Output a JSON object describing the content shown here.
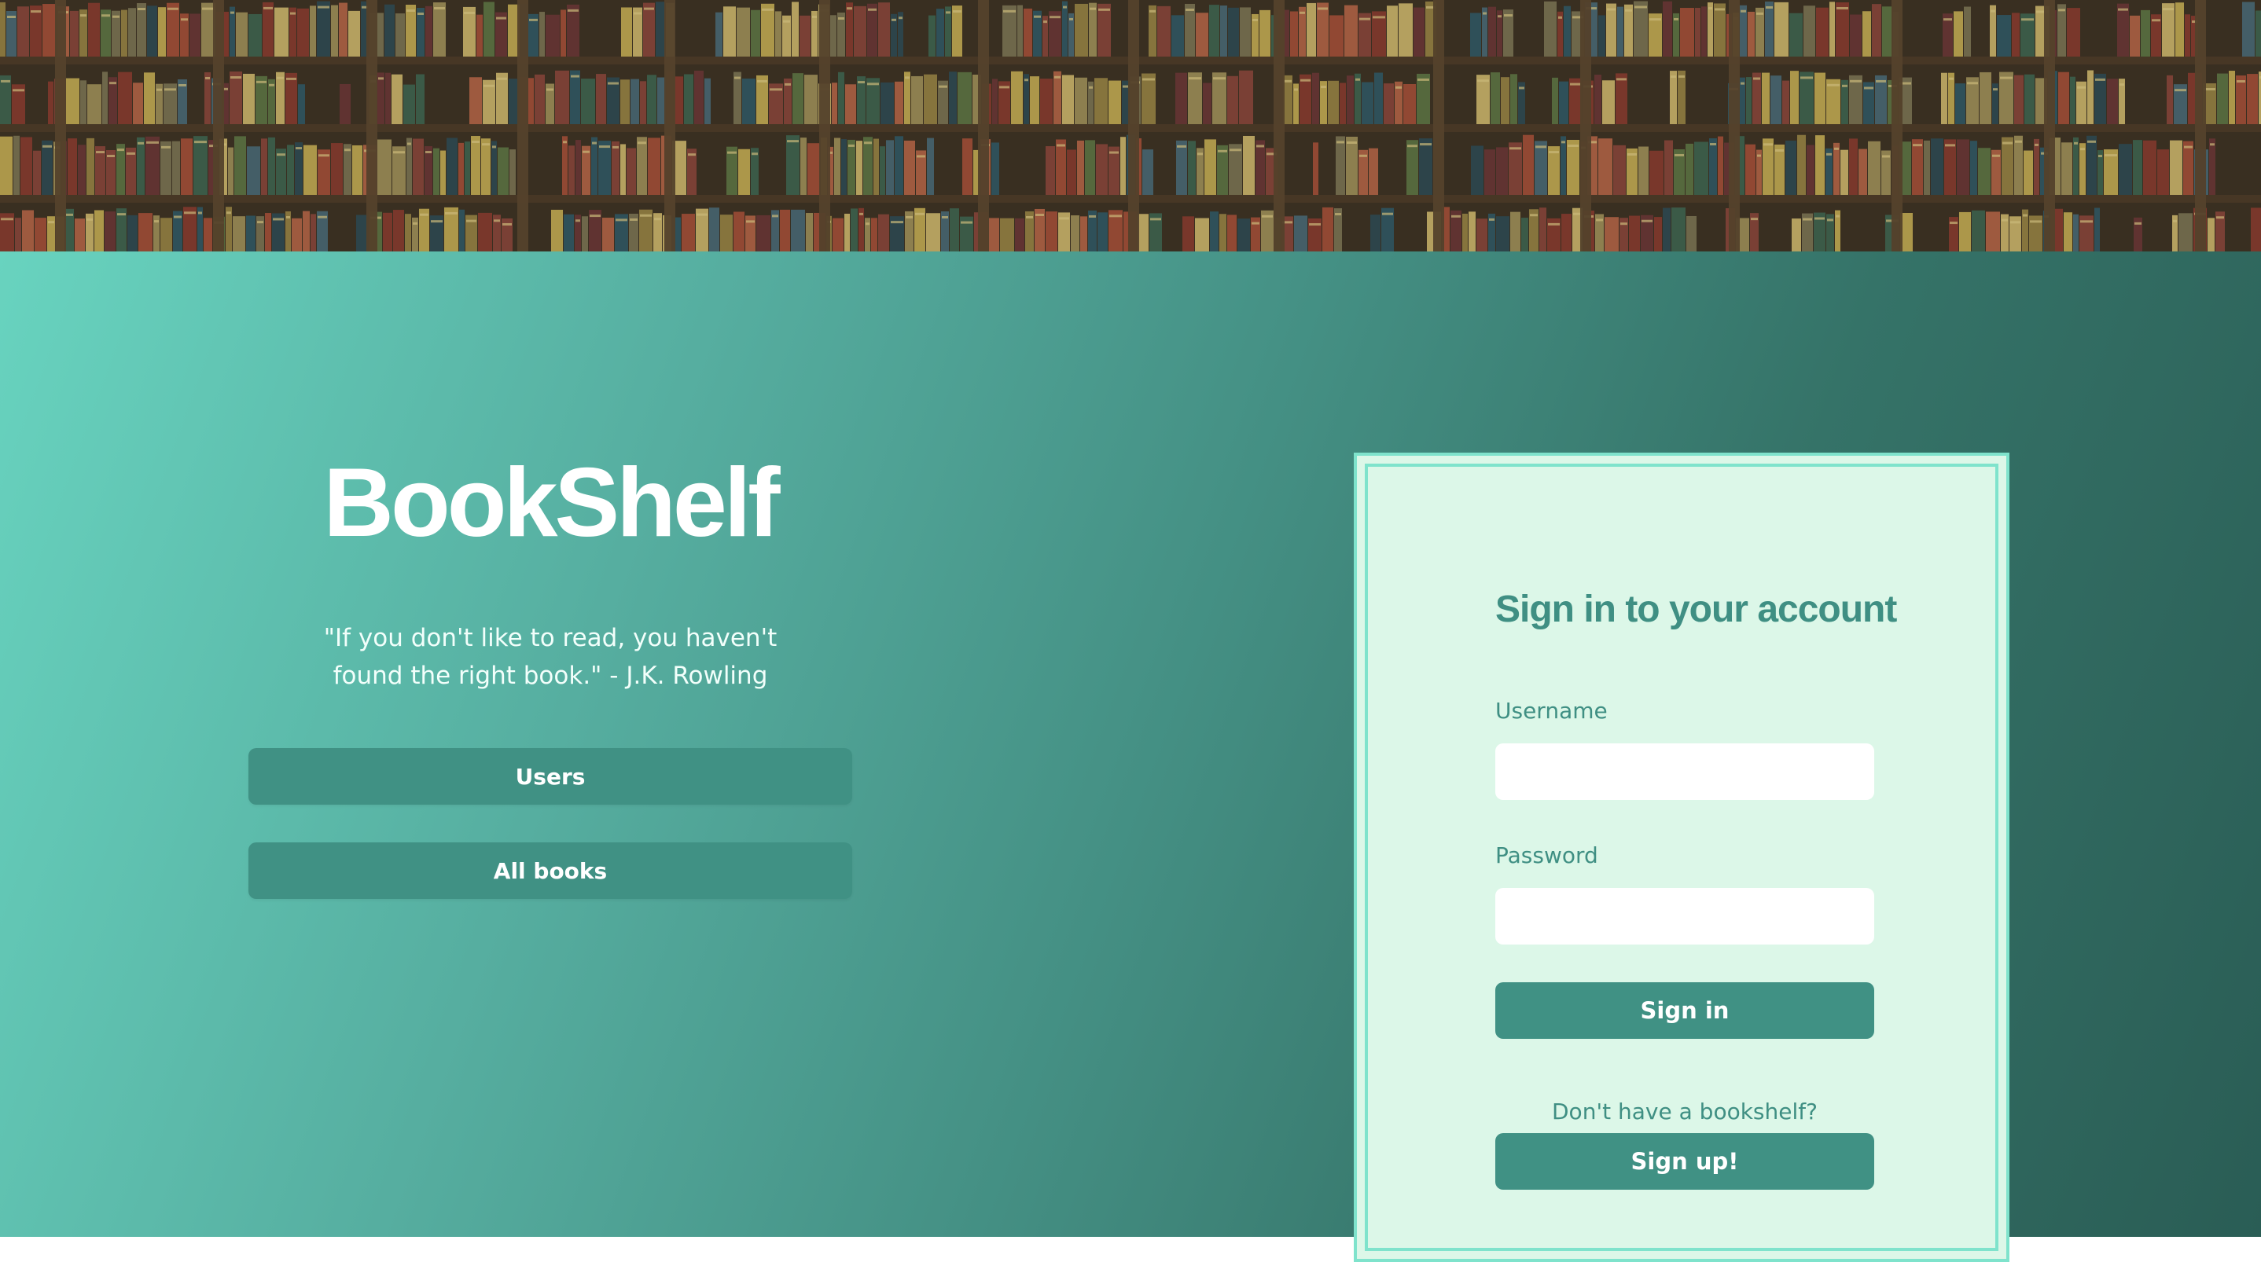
{
  "banner": {
    "description_icon": "bookshelf-image"
  },
  "brand": {
    "title": "BookShelf",
    "quote": "\"If you don't like to read, you haven't found the right book.\" - J.K. Rowling"
  },
  "nav": {
    "users_label": "Users",
    "all_books_label": "All books"
  },
  "signin": {
    "title": "Sign in to your account",
    "username_label": "Username",
    "username_value": "",
    "password_label": "Password",
    "password_value": "",
    "submit_label": "Sign in",
    "signup_prompt": "Don't have a bookshelf?",
    "signup_label": "Sign up!"
  },
  "colors": {
    "accent": "#409184",
    "card_background": "#dcf7e8",
    "card_border": "#7fe3cc",
    "gradient_start": "#68d3bf",
    "gradient_end": "#2a5d55"
  }
}
